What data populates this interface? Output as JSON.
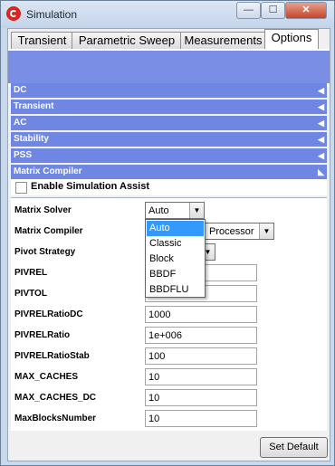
{
  "window": {
    "title": "Simulation",
    "minimize": "—",
    "maximize": "☐",
    "close": "✕"
  },
  "tabs": [
    "Transient",
    "Parametric Sweep",
    "Measurements",
    "Options"
  ],
  "active_tab": "Options",
  "sections": [
    {
      "label": "DC",
      "arrow": "◀"
    },
    {
      "label": "Transient",
      "arrow": "◀"
    },
    {
      "label": "AC",
      "arrow": "◀"
    },
    {
      "label": "Stability",
      "arrow": "◀"
    },
    {
      "label": "PSS",
      "arrow": "◀"
    },
    {
      "label": "Matrix Compiler",
      "arrow": "◣"
    }
  ],
  "assist": {
    "label": "Enable Simulation Assist",
    "checked": false
  },
  "form": {
    "matrix_solver": {
      "label": "Matrix Solver",
      "value": "Auto"
    },
    "matrix_compiler": {
      "label": "Matrix Compiler",
      "value_suffix": "Processor"
    },
    "pivot_strategy": {
      "label": "Pivot Strategy"
    },
    "pivrel": {
      "label": "PIVREL",
      "value": ""
    },
    "pivtol": {
      "label": "PIVTOL",
      "value": ""
    },
    "pivrel_ratio_dc": {
      "label": "PIVRELRatioDC",
      "value": "1000"
    },
    "pivrel_ratio": {
      "label": "PIVRELRatio",
      "value": "1e+006"
    },
    "pivrel_ratio_stab": {
      "label": "PIVRELRatioStab",
      "value": "100"
    },
    "max_caches": {
      "label": "MAX_CACHES",
      "value": "10"
    },
    "max_caches_dc": {
      "label": "MAX_CACHES_DC",
      "value": "10"
    },
    "max_blocks_number": {
      "label": "MaxBlocksNumber",
      "value": "10"
    }
  },
  "solver_options": [
    "Auto",
    "Classic",
    "Block",
    "BBDF",
    "BBDFLU"
  ],
  "selected_option": "Auto",
  "set_default_label": "Set Default",
  "dropdown_arrow": "▼",
  "colors": {
    "section_bar": "#6f86e2",
    "banner": "#7b8ee6",
    "selection": "#3399ff"
  }
}
